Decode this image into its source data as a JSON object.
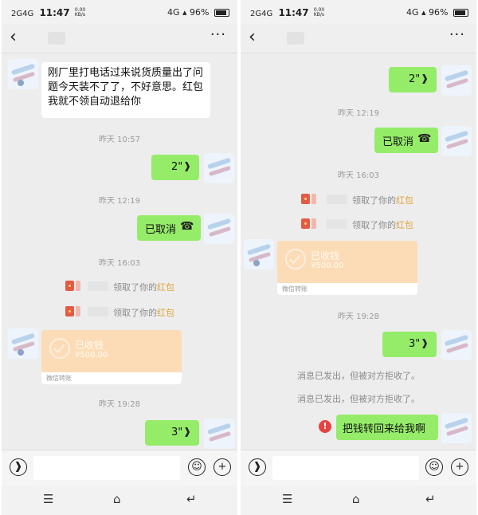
{
  "status_bar": {
    "signal": "2G",
    "signal2": "4G",
    "time": "11:47",
    "speed": "0.00",
    "speed_unit": "KB/s",
    "net": "4G",
    "battery": "96%"
  },
  "nav": {
    "back_icon": "chevron-left-icon",
    "more_icon": "more-horizontal-icon"
  },
  "red_packet_text": {
    "prefix": "领取了你的",
    "highlight": "红包"
  },
  "transfer": {
    "status": "已收钱",
    "amount": "¥500.00",
    "footer": "微信转账"
  },
  "left": {
    "message1": "刚厂里打电话过来说货质量出了问题今天装不了了，不好意思。红包我就不领自动退给你",
    "times": [
      "昨天 10:57",
      "昨天 12:19",
      "昨天 16:03",
      "昨天 19:28"
    ],
    "voice1": "2\"",
    "call_cancel": "已取消",
    "voice2": "3\""
  },
  "right": {
    "voice1": "2\"",
    "times": [
      "昨天 12:19",
      "昨天 16:03",
      "昨天 19:28"
    ],
    "call_cancel": "已取消",
    "voice2": "3\"",
    "rejected": "消息已发出，但被对方拒收了。",
    "final_message": "把钱转回来给我啊"
  }
}
